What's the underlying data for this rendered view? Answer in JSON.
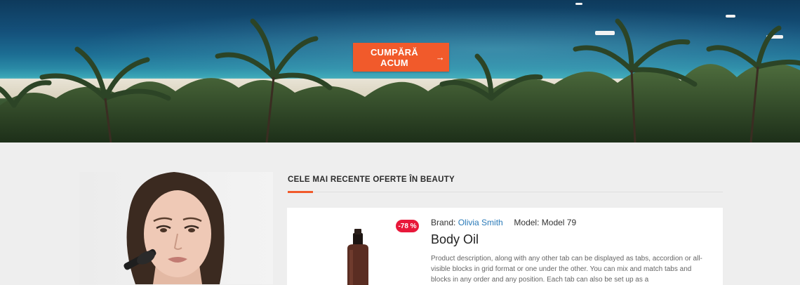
{
  "hero": {
    "cta_label": "CUMPĂRĂ ACUM",
    "cta_icon": "arrow-right-icon",
    "accent_color": "#f15a2b"
  },
  "section": {
    "title": "CELE MAI RECENTE OFERTE ÎN BEAUTY"
  },
  "product": {
    "discount": "-78 %",
    "brand_label": "Brand:",
    "brand_value": "Olivia Smith",
    "model_label": "Model:",
    "model_value": "Model 79",
    "name": "Body Oil",
    "description": "Product description, along with any other tab can be displayed as tabs, accordion or all-visible blocks in grid format or one under the other.  You can mix and match tabs and blocks in any order and any position. Each tab can also be set up as a"
  }
}
